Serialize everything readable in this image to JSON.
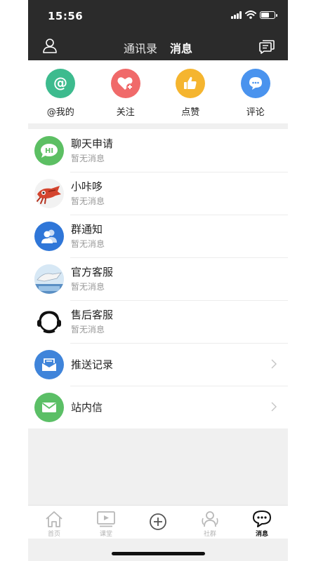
{
  "status": {
    "time": "15:56"
  },
  "header": {
    "tabs": [
      {
        "label": "通讯录",
        "active": false
      },
      {
        "label": "消息",
        "active": true
      }
    ]
  },
  "quick_actions": [
    {
      "label": "@我的",
      "icon": "at-icon",
      "color": "#3dbb8e"
    },
    {
      "label": "关注",
      "icon": "heart-plus-icon",
      "color": "#f06a6a"
    },
    {
      "label": "点赞",
      "icon": "thumbs-up-icon",
      "color": "#f5b52f"
    },
    {
      "label": "评论",
      "icon": "comment-icon",
      "color": "#4a93ee"
    }
  ],
  "messages": [
    {
      "title": "聊天申请",
      "subtitle": "暂无消息",
      "icon": "hi-bubble-icon",
      "color": "#5cbf63"
    },
    {
      "title": "小咔哆",
      "subtitle": "暂无消息",
      "icon": "squid-avatar"
    },
    {
      "title": "群通知",
      "subtitle": "暂无消息",
      "icon": "group-icon",
      "color": "#2f76d8"
    },
    {
      "title": "官方客服",
      "subtitle": "暂无消息",
      "icon": "official-service-avatar"
    },
    {
      "title": "售后客服",
      "subtitle": "暂无消息",
      "icon": "headset-icon"
    },
    {
      "title": "推送记录",
      "icon": "inbox-icon",
      "color": "#3f84da"
    },
    {
      "title": "站内信",
      "icon": "mail-icon",
      "color": "#5bbf66"
    }
  ],
  "tabbar": [
    {
      "label": "首页",
      "icon": "home-icon",
      "active": false
    },
    {
      "label": "课堂",
      "icon": "video-icon",
      "active": false
    },
    {
      "label": "",
      "icon": "plus-icon",
      "active": false
    },
    {
      "label": "社群",
      "icon": "community-icon",
      "active": false
    },
    {
      "label": "消息",
      "icon": "message-icon",
      "active": true
    }
  ]
}
